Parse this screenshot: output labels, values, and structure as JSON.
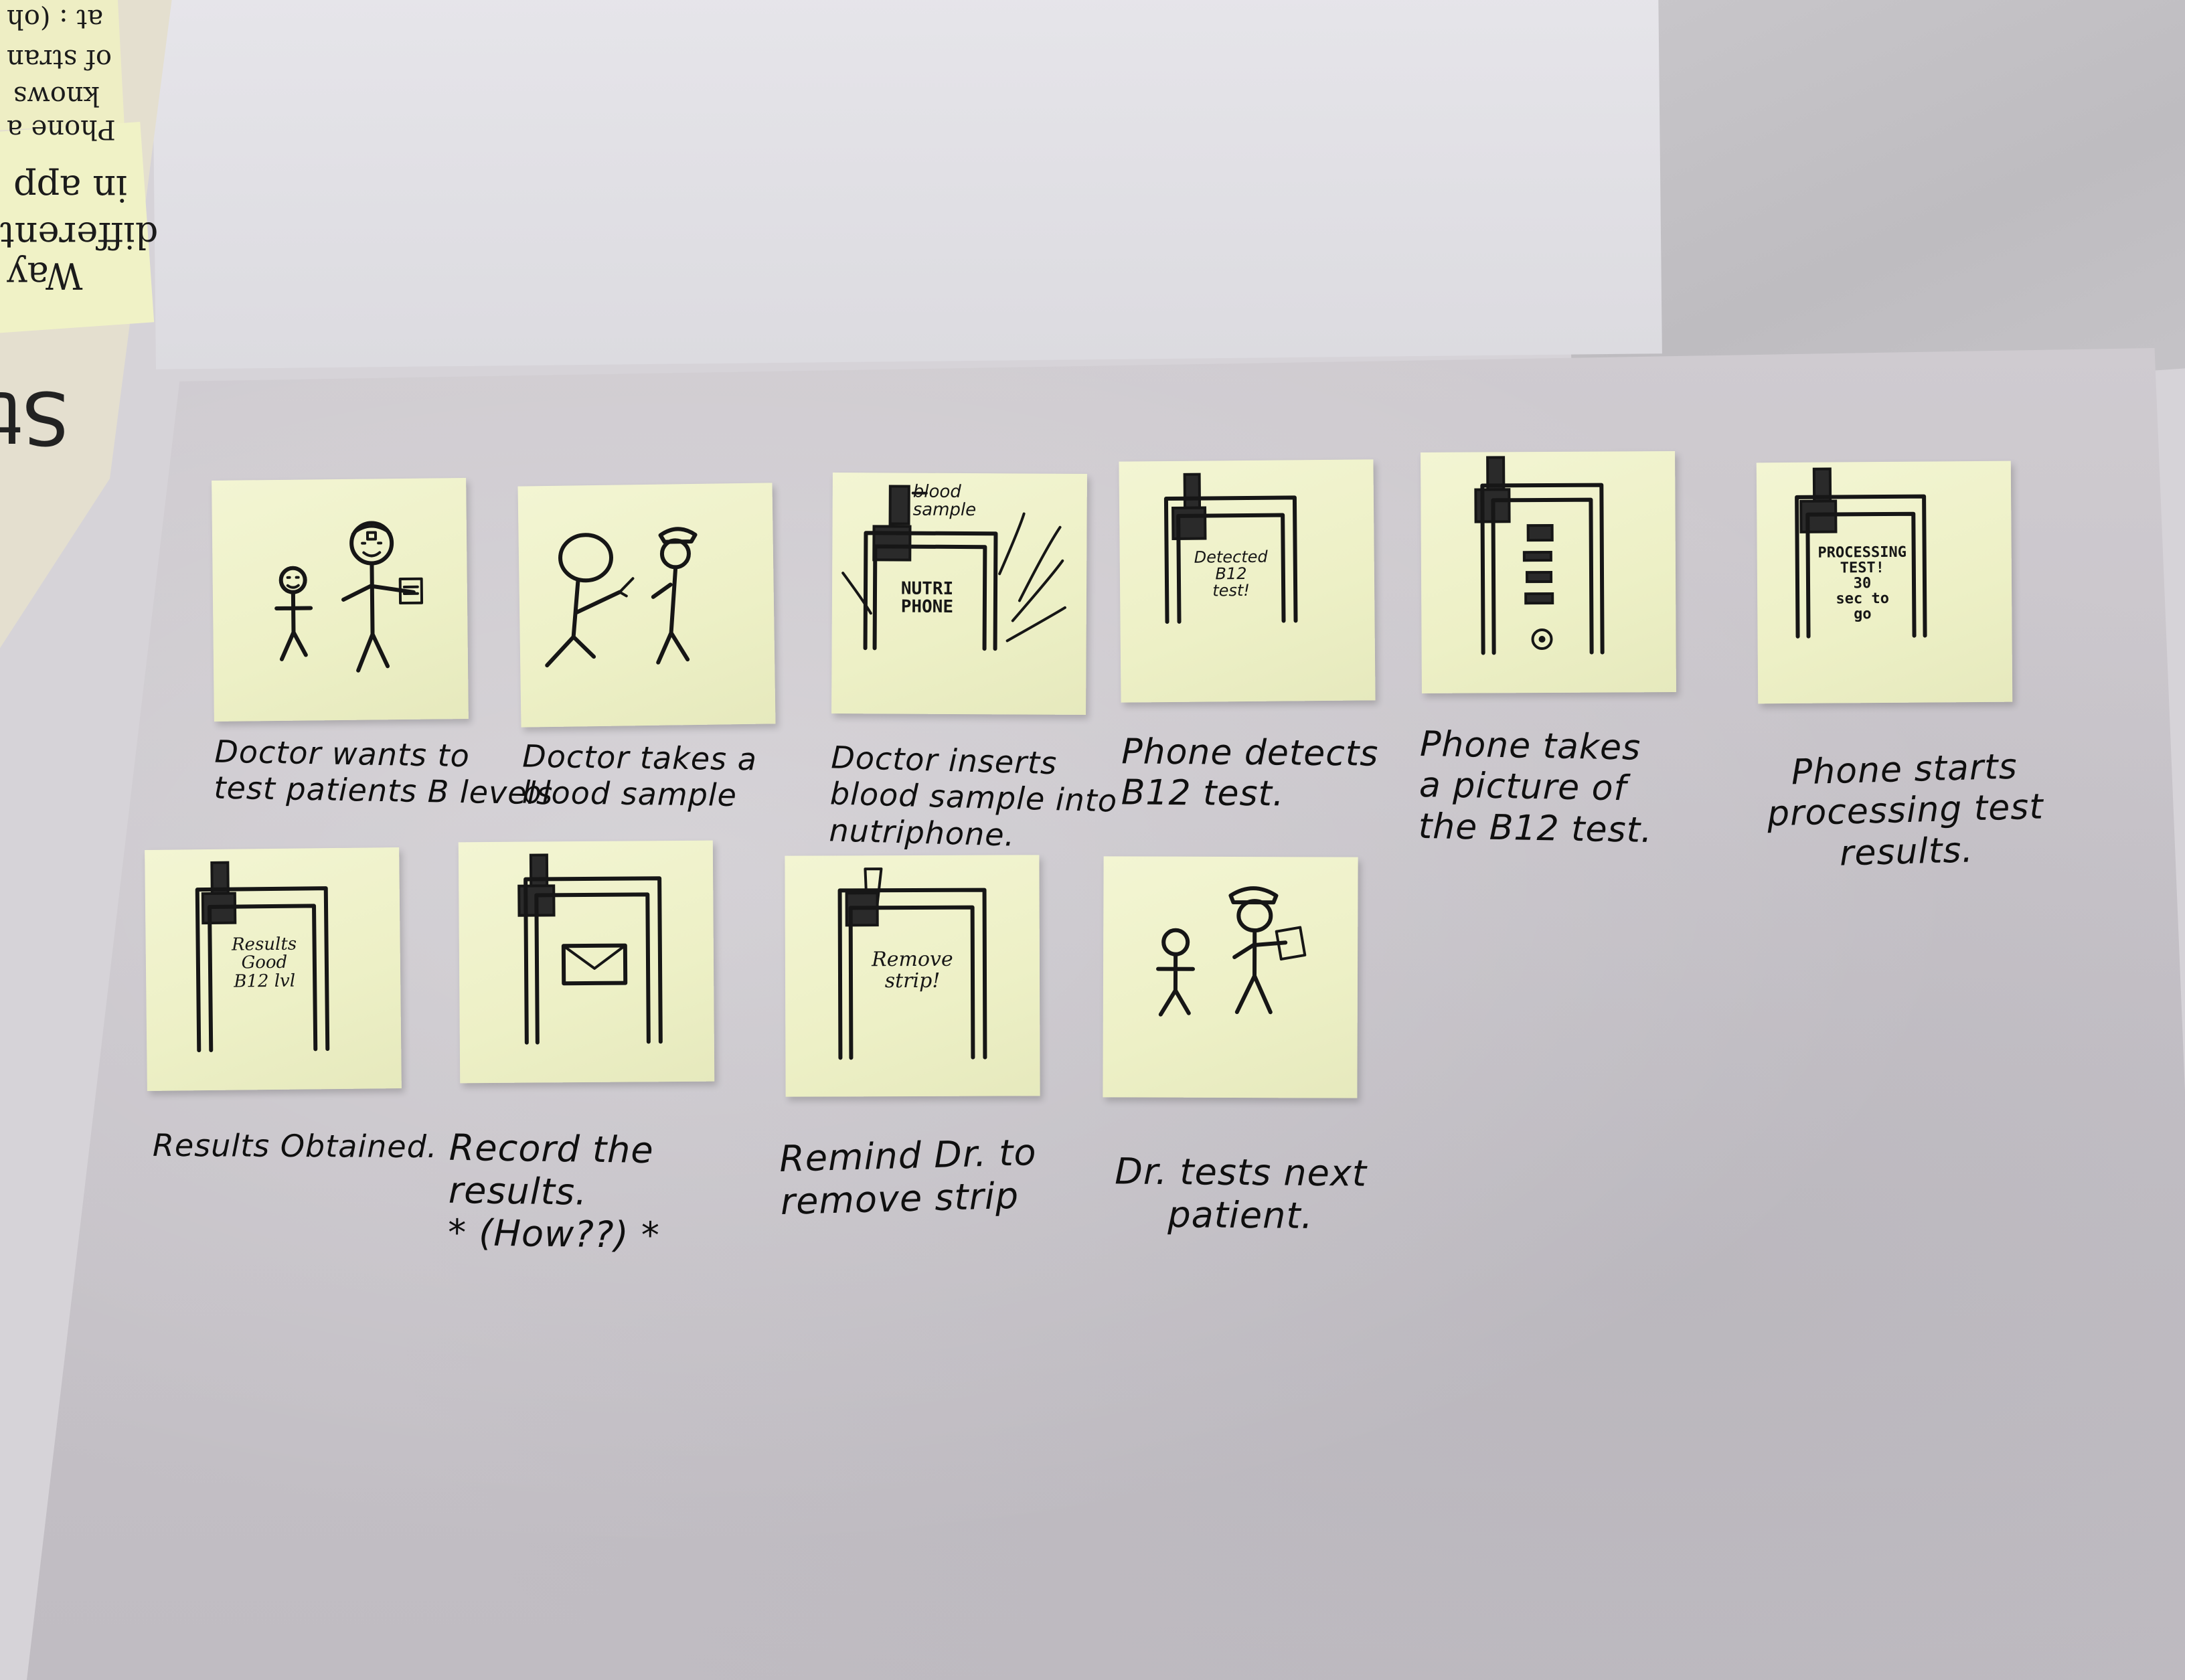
{
  "background": {
    "left_scribbles": [
      "Way",
      "different",
      "in app",
      "Phone a",
      "knows",
      "of stran",
      "at : (oh"
    ],
    "left_label": "St"
  },
  "storyboard": {
    "panels": [
      {
        "caption": "Doctor wants to\ntest patients B levels",
        "screen_text": ""
      },
      {
        "caption": "Doctor takes a\nblood sample",
        "screen_text": ""
      },
      {
        "caption": "Doctor inserts\nblood sample into\nnutriphone.",
        "screen_text": "NUTRI\nPHONE",
        "side_label": "blood\nsample"
      },
      {
        "caption": "Phone detects\nB12 test.",
        "screen_text": "Detected\nB12\ntest!"
      },
      {
        "caption": "Phone takes\na picture of\nthe B12 test.",
        "screen_text": ""
      },
      {
        "caption": "Phone starts\nprocessing test\nresults.",
        "screen_text": "PROCESSING\nTEST!\n30\nsec to\ngo"
      },
      {
        "caption": "Results Obtained.",
        "screen_text": "Results\nGood\nB12 lvl"
      },
      {
        "caption": "Record the\nresults.\n* (How??) *",
        "screen_text": ""
      },
      {
        "caption": "Remind Dr. to\nremove strip",
        "screen_text": "Remove\nstrip!"
      },
      {
        "caption": "Dr. tests next\npatient.",
        "screen_text": ""
      }
    ]
  }
}
